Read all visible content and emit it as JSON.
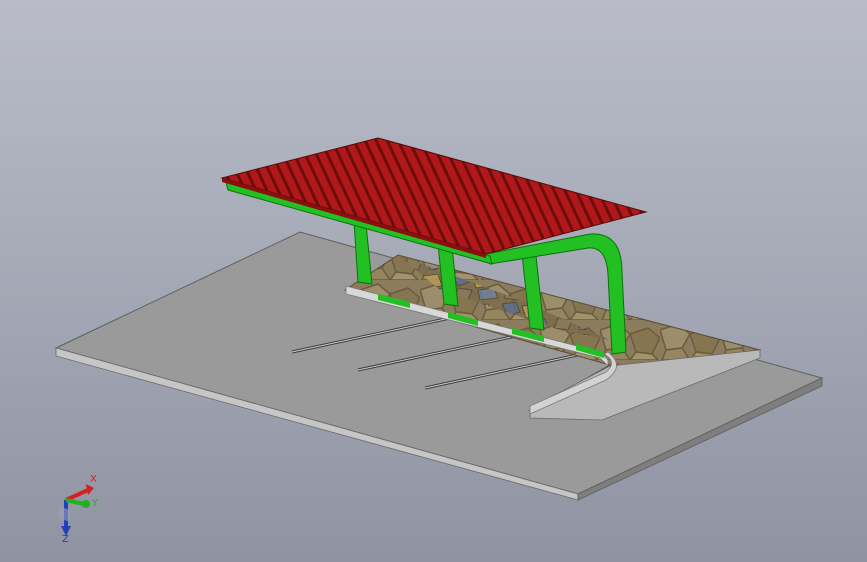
{
  "viewport": {
    "background_top": "#b9bcc8",
    "background_bottom": "#8f93a2"
  },
  "model": {
    "roof_color": "#b0181a",
    "frame_color": "#22c022",
    "slab_color": "#9a9a9a",
    "paving_color": "#8a7a5a",
    "curb_color": "#c8c8c8"
  },
  "triad": {
    "x_label": "X",
    "y_label": "Y",
    "z_label": "Z",
    "x_color": "#d42020",
    "y_color": "#20b020",
    "z_color": "#2040c0"
  }
}
